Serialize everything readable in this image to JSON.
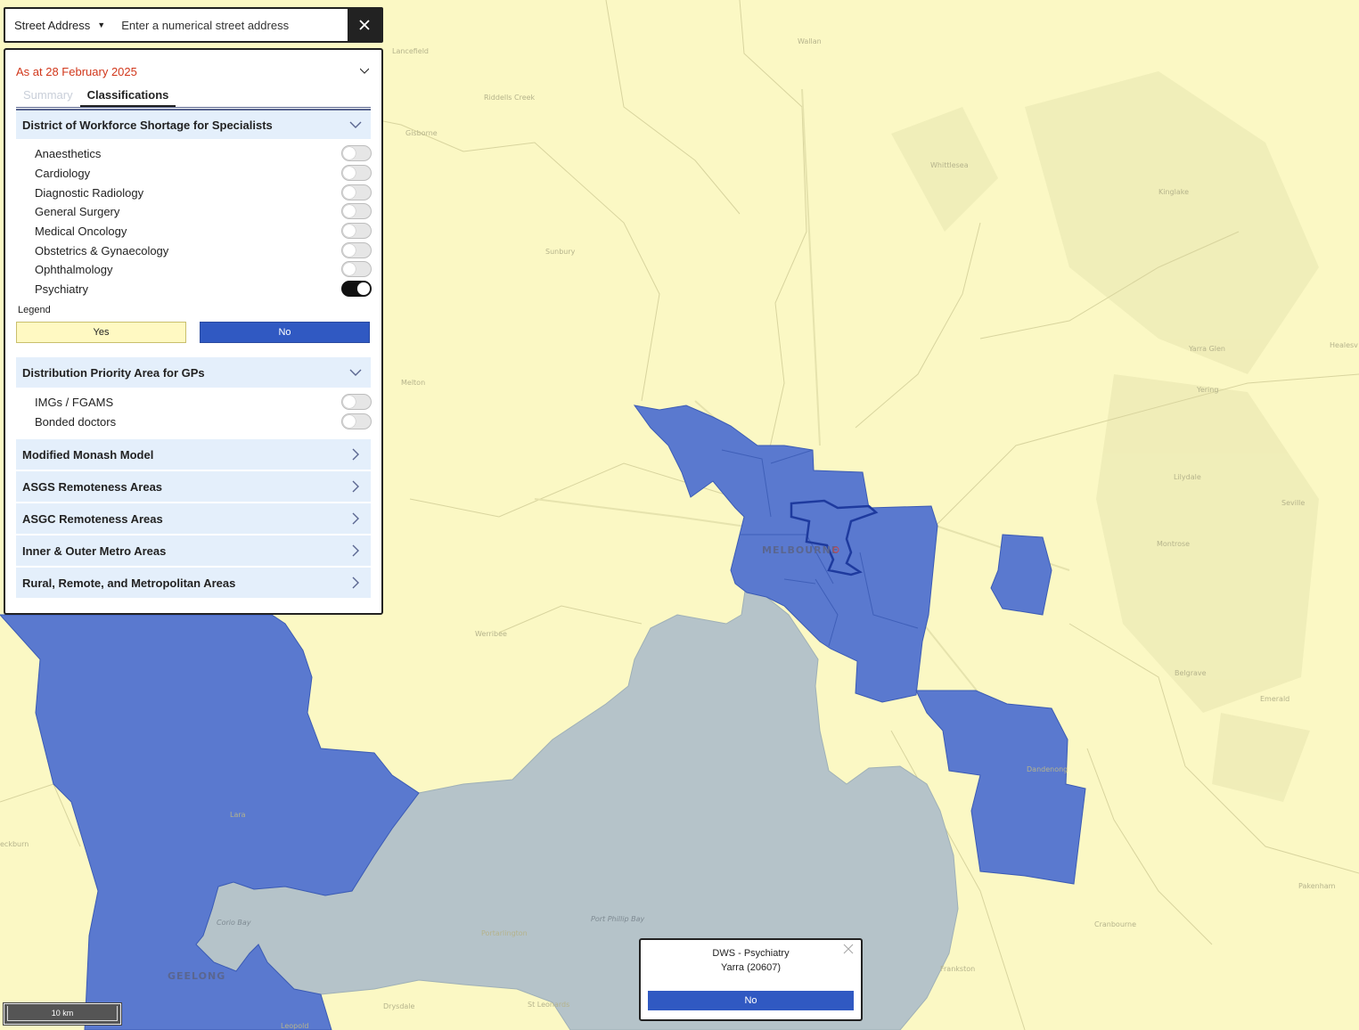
{
  "search": {
    "type_label": "Street Address",
    "placeholder": "Enter a numerical street address",
    "clear_icon": "close-icon"
  },
  "panel": {
    "as_at": "As at 28 February 2025",
    "tabs": [
      {
        "label": "Summary",
        "active": false
      },
      {
        "label": "Classifications",
        "active": true
      }
    ],
    "dws": {
      "title": "District of Workforce Shortage for Specialists",
      "toggles": [
        {
          "label": "Anaesthetics",
          "on": false
        },
        {
          "label": "Cardiology",
          "on": false
        },
        {
          "label": "Diagnostic Radiology",
          "on": false
        },
        {
          "label": "General Surgery",
          "on": false
        },
        {
          "label": "Medical Oncology",
          "on": false
        },
        {
          "label": "Obstetrics & Gynaecology",
          "on": false
        },
        {
          "label": "Ophthalmology",
          "on": false
        },
        {
          "label": "Psychiatry",
          "on": true
        }
      ],
      "legend_title": "Legend",
      "legend": [
        {
          "label": "Yes",
          "color": "#fff9c2"
        },
        {
          "label": "No",
          "color": "#3059c2"
        }
      ]
    },
    "dpa": {
      "title": "Distribution Priority Area for GPs",
      "toggles": [
        {
          "label": "IMGs / FGAMS",
          "on": false
        },
        {
          "label": "Bonded doctors",
          "on": false
        }
      ]
    },
    "collapsed_sections": [
      "Modified Monash Model",
      "ASGS Remoteness Areas",
      "ASGC Remoteness Areas",
      "Inner & Outer Metro Areas",
      "Rural, Remote, and Metropolitan Areas"
    ]
  },
  "popup": {
    "title": "DWS - Psychiatry",
    "area": "Yarra (20607)",
    "value": "No"
  },
  "scale": {
    "label": "10 km"
  },
  "map": {
    "colors": {
      "land": "#fbf8c4",
      "water": "#b5c3c9",
      "dws_no": "#5a79cf",
      "boundary": "#1e3a9e"
    },
    "places": {
      "melbourne": "MELBOURNE",
      "geelong": "GEELONG",
      "port_phillip_bay": "Port Phillip Bay",
      "corio_bay": "Corio Bay",
      "wallan": "Wallan",
      "riddells_creek": "Riddells Creek",
      "gisborne": "Gisborne",
      "whittlesea": "Whittlesea",
      "kinglake": "Kinglake",
      "sunbury": "Sunbury",
      "melton": "Melton",
      "werribee": "Werribee",
      "yarra_glen": "Yarra Glen",
      "yering": "Yering",
      "lilydale": "Lilydale",
      "montrose": "Montrose",
      "seville": "Seville",
      "belgrave": "Belgrave",
      "emerald": "Emerald",
      "dandenong": "Dandenong",
      "pakenham": "Pakenham",
      "cranbourne": "Cranbourne",
      "frankston": "Frankston",
      "lara": "Lara",
      "portarlington": "Portarlington",
      "drysdale": "Drysdale",
      "st_leonards": "St Leonards",
      "leopold": "Leopold",
      "lancefield": "Lancefield",
      "healesville": "Healesv",
      "bacchus": "eckburn"
    }
  }
}
